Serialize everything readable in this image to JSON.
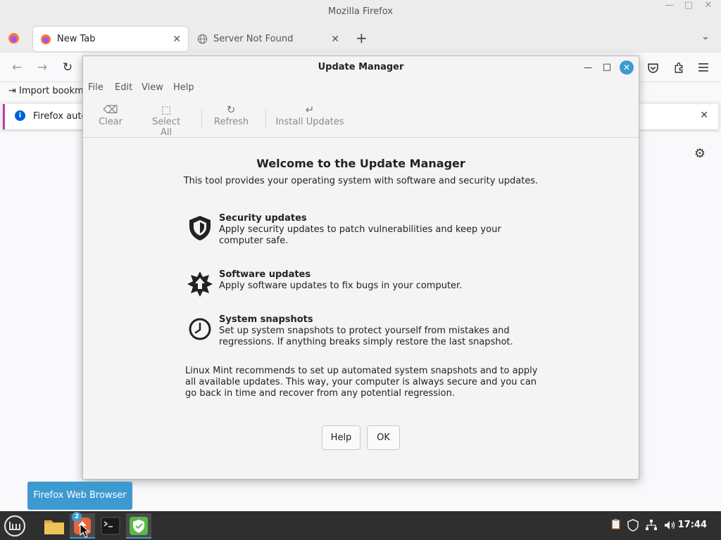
{
  "firefox": {
    "window_title": "Mozilla Firefox",
    "tabs": [
      {
        "label": "New Tab",
        "active": true
      },
      {
        "label": "Server Not Found",
        "active": false
      }
    ],
    "new_tab_symbol": "+",
    "bookmarks": {
      "import_label": "Import bookm"
    },
    "notice": {
      "text": "Firefox auto"
    }
  },
  "update_manager": {
    "title": "Update Manager",
    "menu": [
      "File",
      "Edit",
      "View",
      "Help"
    ],
    "toolbar": {
      "clear_label": "Clear",
      "select_all_label": "Select All",
      "refresh_label": "Refresh",
      "install_label": "Install Updates"
    },
    "welcome": {
      "title": "Welcome to the Update Manager",
      "subtitle": "This tool provides your operating system with software and security updates."
    },
    "features": [
      {
        "icon": "shield-icon",
        "title": "Security updates",
        "description": "Apply security updates to patch vulnerabilities and keep your computer safe."
      },
      {
        "icon": "starburst-arrow-icon",
        "title": "Software updates",
        "description": "Apply software updates to fix bugs in your computer."
      },
      {
        "icon": "clock-icon",
        "title": "System snapshots",
        "description": "Set up system snapshots to protect yourself from mistakes and regressions. If anything breaks simply restore the last snapshot."
      }
    ],
    "recommendation": "Linux Mint recommends to set up automated system snapshots and to apply all available updates. This way, your computer is always secure and you can go back in time and recover from any potential regression.",
    "buttons": {
      "help_label": "Help",
      "ok_label": "OK"
    }
  },
  "tooltip": {
    "text": "Firefox Web Browser"
  },
  "taskbar": {
    "badge_count": "2",
    "clock": "17:44"
  },
  "colors": {
    "accent": "#3d9ad1",
    "taskbar_bg": "#2f2f2f",
    "notice_border": "#c03ea8"
  }
}
